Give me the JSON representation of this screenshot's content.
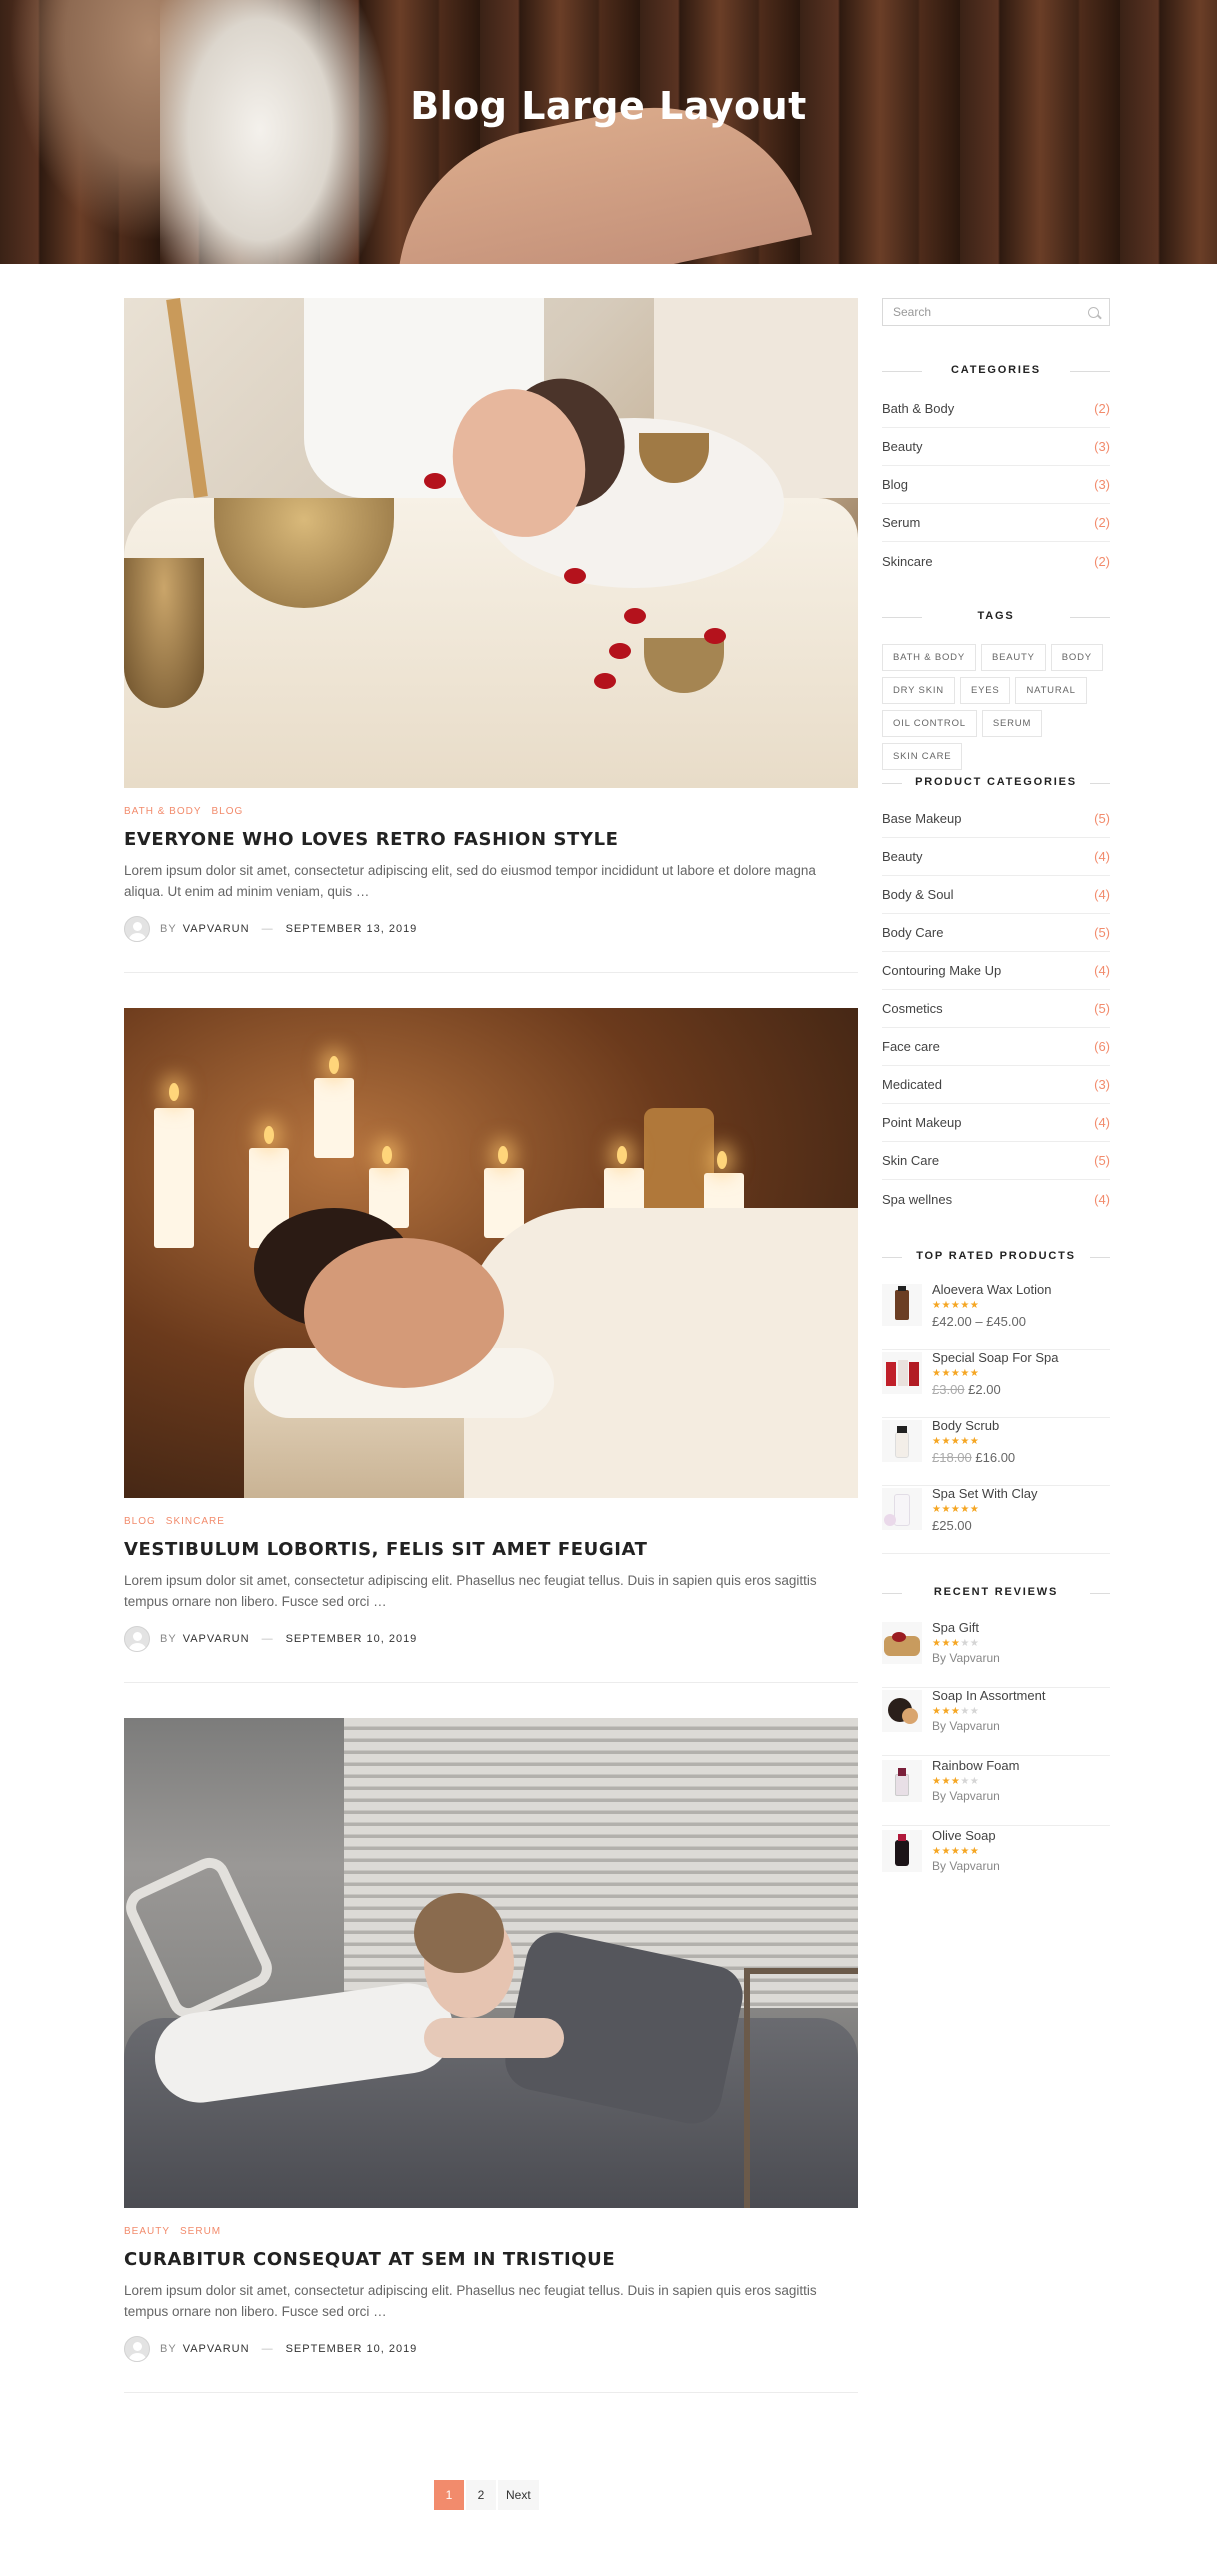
{
  "hero": {
    "title": "Blog Large Layout"
  },
  "posts": [
    {
      "categories": [
        "BATH & BODY",
        "BLOG"
      ],
      "title": "EVERYONE WHO LOVES RETRO FASHION STYLE",
      "excerpt": "Lorem ipsum dolor sit amet, consectetur adipiscing elit, sed do eiusmod tempor incididunt ut labore et dolore magna aliqua. Ut enim ad minim veniam, quis …",
      "by": "BY",
      "author": "VAPVARUN",
      "date": "SEPTEMBER 13, 2019"
    },
    {
      "categories": [
        "BLOG",
        "SKINCARE"
      ],
      "title": "VESTIBULUM LOBORTIS, FELIS SIT AMET FEUGIAT",
      "excerpt": "Lorem ipsum dolor sit amet, consectetur adipiscing elit. Phasellus nec feugiat tellus. Duis in sapien quis eros sagittis tempus ornare non libero. Fusce sed orci …",
      "by": "BY",
      "author": "VAPVARUN",
      "date": "SEPTEMBER 10, 2019"
    },
    {
      "categories": [
        "BEAUTY",
        "SERUM"
      ],
      "title": "CURABITUR CONSEQUAT AT SEM IN TRISTIQUE",
      "excerpt": "Lorem ipsum dolor sit amet, consectetur adipiscing elit. Phasellus nec feugiat tellus. Duis in sapien quis eros sagittis tempus ornare non libero. Fusce sed orci …",
      "by": "BY",
      "author": "VAPVARUN",
      "date": "SEPTEMBER 10, 2019"
    }
  ],
  "sidebar": {
    "search_placeholder": "Search",
    "categories_title": "CATEGORIES",
    "categories": [
      {
        "name": "Bath & Body",
        "count": "(2)"
      },
      {
        "name": "Beauty",
        "count": "(3)"
      },
      {
        "name": "Blog",
        "count": "(3)"
      },
      {
        "name": "Serum",
        "count": "(2)"
      },
      {
        "name": "Skincare",
        "count": "(2)"
      }
    ],
    "tags_title": "TAGS",
    "tags": [
      "BATH & BODY",
      "BEAUTY",
      "BODY",
      "DRY SKIN",
      "EYES",
      "NATURAL",
      "OIL CONTROL",
      "SERUM",
      "SKIN CARE"
    ],
    "product_categories_title": "PRODUCT CATEGORIES",
    "product_categories": [
      {
        "name": "Base Makeup",
        "count": "(5)"
      },
      {
        "name": "Beauty",
        "count": "(4)"
      },
      {
        "name": "Body & Soul",
        "count": "(4)"
      },
      {
        "name": "Body Care",
        "count": "(5)"
      },
      {
        "name": "Contouring Make Up",
        "count": "(4)"
      },
      {
        "name": "Cosmetics",
        "count": "(5)"
      },
      {
        "name": "Face care",
        "count": "(6)"
      },
      {
        "name": "Medicated",
        "count": "(3)"
      },
      {
        "name": "Point Makeup",
        "count": "(4)"
      },
      {
        "name": "Skin Care",
        "count": "(5)"
      },
      {
        "name": "Spa wellnes",
        "count": "(4)"
      }
    ],
    "top_rated_title": "TOP RATED PRODUCTS",
    "top_rated": [
      {
        "name": "Aloevera Wax Lotion",
        "rating": 5,
        "price": "£42.00 – £45.00",
        "old_price": ""
      },
      {
        "name": "Special Soap For Spa",
        "rating": 5,
        "price": "£2.00",
        "old_price": "£3.00"
      },
      {
        "name": "Body Scrub",
        "rating": 5,
        "price": "£16.00",
        "old_price": "£18.00"
      },
      {
        "name": "Spa Set With Clay",
        "rating": 5,
        "price": "£25.00",
        "old_price": ""
      }
    ],
    "recent_reviews_title": "RECENT REVIEWS",
    "recent_reviews": [
      {
        "name": "Spa Gift",
        "rating": 3,
        "by": "By Vapvarun"
      },
      {
        "name": "Soap In Assortment",
        "rating": 3,
        "by": "By Vapvarun"
      },
      {
        "name": "Rainbow Foam",
        "rating": 3,
        "by": "By Vapvarun"
      },
      {
        "name": "Olive Soap",
        "rating": 5,
        "by": "By Vapvarun"
      }
    ]
  },
  "pagination": {
    "pages": [
      "1",
      "2"
    ],
    "current": "1",
    "next": "Next"
  },
  "colors": {
    "accent": "#f28b6c",
    "star": "#f5a623"
  }
}
